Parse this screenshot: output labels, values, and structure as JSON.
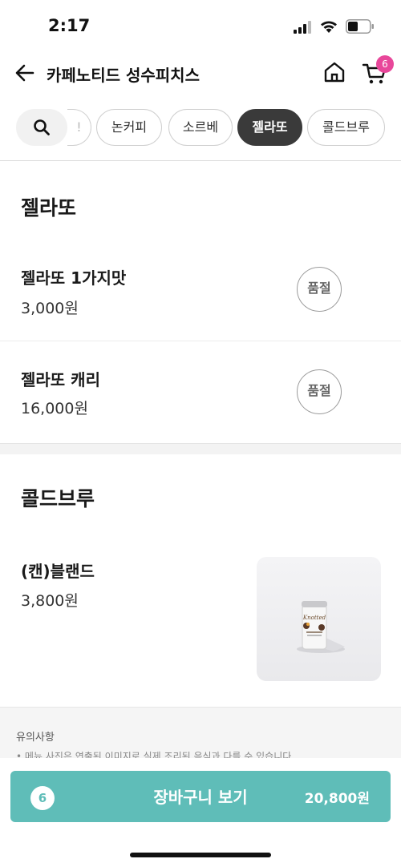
{
  "status_bar": {
    "time": "2:17"
  },
  "header": {
    "store_name": "카페노티드 성수피치스",
    "cart_count": "6"
  },
  "categories": {
    "partial_label": "!",
    "chips": [
      {
        "label": "논커피",
        "active": false
      },
      {
        "label": "소르베",
        "active": false
      },
      {
        "label": "젤라또",
        "active": true
      },
      {
        "label": "콜드브루",
        "active": false
      }
    ]
  },
  "sections": [
    {
      "title": "젤라또",
      "items": [
        {
          "name": "젤라또 1가지맛",
          "price": "3,000원",
          "badge": "품절"
        },
        {
          "name": "젤라또 캐리",
          "price": "16,000원",
          "badge": "품절"
        }
      ]
    },
    {
      "title": "콜드브루",
      "items": [
        {
          "name": "(캔)블랜드",
          "price": "3,800원",
          "image_label": "Knotted"
        }
      ]
    }
  ],
  "notice": {
    "title": "유의사항",
    "text": "• 메뉴 사진은 연출된 이미지로 실제 조리된 음식과 다를 수 있습니다"
  },
  "bottom_bar": {
    "count": "6",
    "label": "장바구니 보기",
    "total": "20,800원",
    "accent": "#5fbdb8"
  }
}
